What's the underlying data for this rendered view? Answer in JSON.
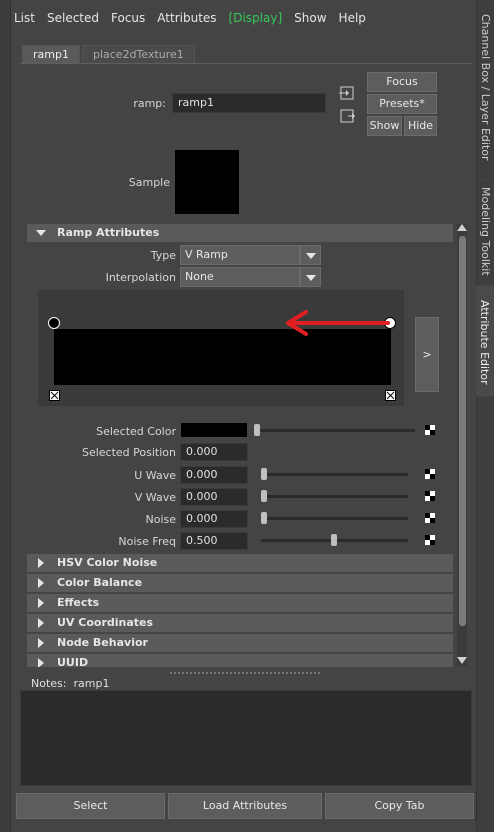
{
  "menu": [
    "List",
    "Selected",
    "Focus",
    "Attributes",
    "Display",
    "Show",
    "Help"
  ],
  "menu_active_index": 4,
  "tabs": [
    "ramp1",
    "place2dTexture1"
  ],
  "active_tab": 0,
  "node": {
    "label": "ramp:",
    "value": "ramp1",
    "buttons": {
      "focus": "Focus",
      "presets": "Presets*",
      "show": "Show",
      "hide": "Hide"
    }
  },
  "sample": {
    "label": "Sample",
    "color": "#000000"
  },
  "ramp_attributes": {
    "title": "Ramp Attributes",
    "type": {
      "label": "Type",
      "value": "V Ramp"
    },
    "interpolation": {
      "label": "Interpolation",
      "value": "None"
    },
    "expand_button": ">",
    "selected_color": {
      "label": "Selected Color",
      "color": "#000000"
    },
    "selected_position": {
      "label": "Selected Position",
      "value": "0.000"
    },
    "u_wave": {
      "label": "U Wave",
      "value": "0.000"
    },
    "v_wave": {
      "label": "V Wave",
      "value": "0.000"
    },
    "noise": {
      "label": "Noise",
      "value": "0.000"
    },
    "noise_freq": {
      "label": "Noise Freq",
      "value": "0.500"
    }
  },
  "sections": [
    "HSV Color Noise",
    "Color Balance",
    "Effects",
    "UV Coordinates",
    "Node Behavior",
    "UUID"
  ],
  "notes": {
    "label": "Notes:",
    "value": "ramp1"
  },
  "bottom_buttons": {
    "select": "Select",
    "load": "Load Attributes",
    "copy": "Copy Tab"
  },
  "side_tabs": [
    "Channel Box / Layer Editor",
    "Modeling Toolkit",
    "Attribute Editor"
  ],
  "colors": {
    "accent_green": "#36c85a",
    "arrow_red": "#e02020"
  }
}
